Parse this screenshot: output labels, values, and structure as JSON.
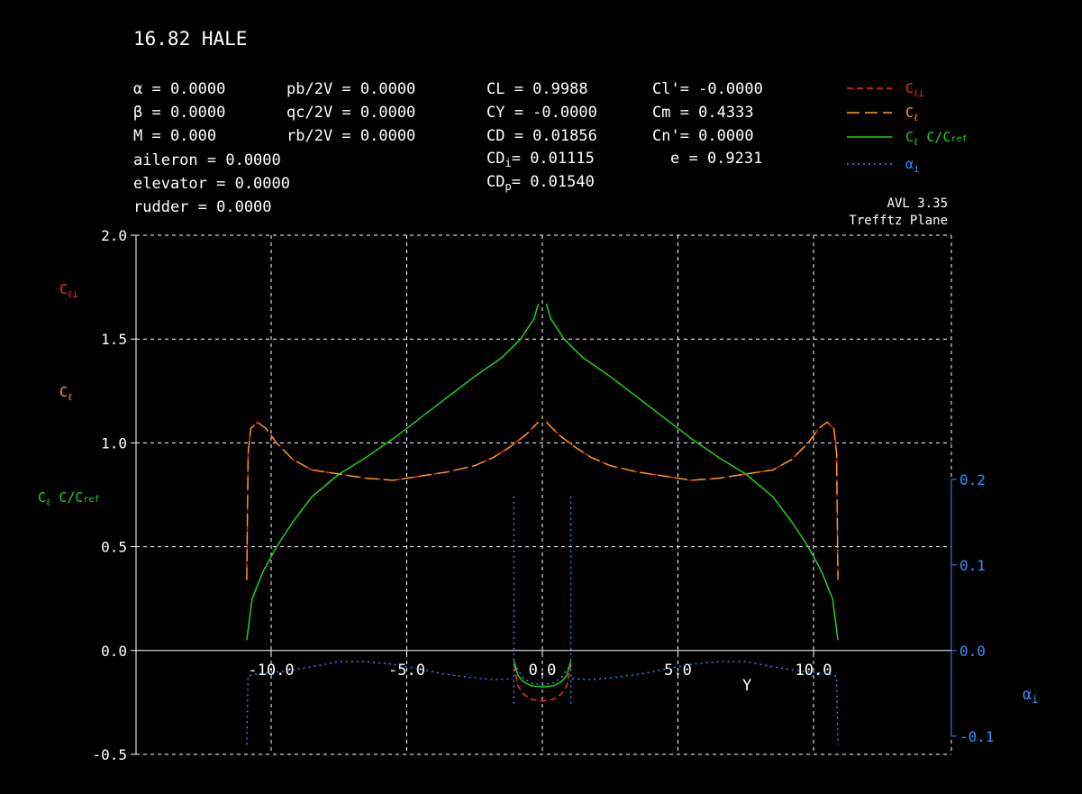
{
  "title": "16.82 HALE",
  "params": {
    "alpha": "α = 0.0000",
    "beta": "β = 0.0000",
    "mach": "M = 0.000",
    "pb2v": "pb/2V = 0.0000",
    "qc2v": "qc/2V = 0.0000",
    "rb2v": "rb/2V = 0.0000",
    "aileron": "aileron  = 0.0000",
    "elevator": "elevator = 0.0000",
    "rudder": "rudder   = 0.0000",
    "CL": "CL = 0.9988",
    "CY": "CY = -0.0000",
    "CD": "CD = 0.01856",
    "CDi_label": "CD",
    "CDi_sub": "i",
    "CDi_value": "= 0.01115",
    "CDp_label": "CD",
    "CDp_sub": "p",
    "CDp_value": "= 0.01540",
    "Cl_prime": "Cl'= -0.0000",
    "Cm": "Cm = 0.4333",
    "Cn_prime": "Cn'= 0.0000",
    "e": "e = 0.9231"
  },
  "version": "AVL 3.35",
  "plane": "Trefftz Plane",
  "colors": {
    "cl_perp": "#ff2a1a",
    "cl": "#ffa020",
    "clc": "#20d020",
    "alpha_i": "#3090ff",
    "grid": "#ffffff",
    "background": "#000000"
  },
  "chart_data": {
    "type": "line",
    "xlabel": "Y",
    "x_ticks": [
      "-10.0",
      "-5.0",
      "0.0",
      "5.0",
      "10.0"
    ],
    "x_tick_values": [
      -10,
      -5,
      0,
      5,
      10
    ],
    "xlim": [
      -10,
      10
    ],
    "ylim": [
      -0.5,
      2.0
    ],
    "y_ticks": [
      "-0.5",
      "0.0",
      "0.5",
      "1.0",
      "1.5",
      "2.0"
    ],
    "y_tick_values": [
      -0.5,
      0,
      0.5,
      1.0,
      1.5,
      2.0
    ],
    "y2lim": [
      -0.1,
      0.2
    ],
    "y2_ticks": [
      "-0.1",
      "0.0",
      "0.1",
      "0.2"
    ],
    "y2_tick_values": [
      -0.1,
      0,
      0.1,
      0.2
    ],
    "legend": [
      {
        "key": "cl_perp",
        "main": "C",
        "sub": "ℓ⊥"
      },
      {
        "key": "cl",
        "main": "C",
        "sub": "ℓ"
      },
      {
        "key": "clc",
        "main": "C",
        "sub": "ℓ",
        "tail": " C/C",
        "tail_sub": "ref"
      },
      {
        "key": "alpha_i",
        "main": "α",
        "sub": "i"
      }
    ],
    "axis_labels": {
      "cl_perp": {
        "main": "C",
        "sub": "ℓ⊥"
      },
      "cl": {
        "main": "C",
        "sub": "ℓ"
      },
      "clc": {
        "main": "C",
        "sub": "ℓ",
        "tail": " C/C",
        "tail_sub": "ref"
      },
      "alpha_i": {
        "main": "α",
        "sub": "i"
      }
    },
    "series": [
      {
        "key": "cl_perp",
        "style": "dashed-short",
        "segments": [
          [
            [
              -10.9,
              0.34
            ],
            [
              -10.85,
              0.95
            ],
            [
              -10.75,
              1.07
            ],
            [
              -10.5,
              1.1
            ],
            [
              -10.2,
              1.07
            ],
            [
              -9.8,
              1.0
            ],
            [
              -9.2,
              0.92
            ],
            [
              -8.5,
              0.87
            ],
            [
              -7.5,
              0.85
            ],
            [
              -6.5,
              0.83
            ],
            [
              -5.5,
              0.82
            ],
            [
              -4.5,
              0.84
            ],
            [
              -3.5,
              0.86
            ],
            [
              -2.5,
              0.89
            ],
            [
              -1.8,
              0.93
            ],
            [
              -1.2,
              0.98
            ],
            [
              -0.6,
              1.04
            ],
            [
              -0.15,
              1.1
            ]
          ],
          [
            [
              0.15,
              1.1
            ],
            [
              0.6,
              1.04
            ],
            [
              1.2,
              0.98
            ],
            [
              1.8,
              0.93
            ],
            [
              2.5,
              0.89
            ],
            [
              3.5,
              0.86
            ],
            [
              4.5,
              0.84
            ],
            [
              5.5,
              0.82
            ],
            [
              6.5,
              0.83
            ],
            [
              7.5,
              0.85
            ],
            [
              8.5,
              0.87
            ],
            [
              9.2,
              0.92
            ],
            [
              9.8,
              1.0
            ],
            [
              10.2,
              1.07
            ],
            [
              10.5,
              1.1
            ],
            [
              10.75,
              1.07
            ],
            [
              10.85,
              0.95
            ],
            [
              10.9,
              0.34
            ]
          ],
          [
            [
              -1.05,
              -0.07
            ],
            [
              -0.9,
              -0.17
            ],
            [
              -0.7,
              -0.21
            ],
            [
              -0.4,
              -0.235
            ],
            [
              0,
              -0.245
            ],
            [
              0.4,
              -0.235
            ],
            [
              0.7,
              -0.21
            ],
            [
              0.9,
              -0.17
            ],
            [
              1.05,
              -0.07
            ]
          ]
        ]
      },
      {
        "key": "cl",
        "style": "dashed-long",
        "segments": [
          [
            [
              -10.9,
              0.34
            ],
            [
              -10.85,
              0.95
            ],
            [
              -10.75,
              1.07
            ],
            [
              -10.5,
              1.1
            ],
            [
              -10.2,
              1.07
            ],
            [
              -9.8,
              1.0
            ],
            [
              -9.2,
              0.92
            ],
            [
              -8.5,
              0.87
            ],
            [
              -7.5,
              0.85
            ],
            [
              -6.5,
              0.83
            ],
            [
              -5.5,
              0.82
            ],
            [
              -4.5,
              0.84
            ],
            [
              -3.5,
              0.86
            ],
            [
              -2.5,
              0.89
            ],
            [
              -1.8,
              0.93
            ],
            [
              -1.2,
              0.98
            ],
            [
              -0.6,
              1.04
            ],
            [
              -0.15,
              1.1
            ]
          ],
          [
            [
              0.15,
              1.1
            ],
            [
              0.6,
              1.04
            ],
            [
              1.2,
              0.98
            ],
            [
              1.8,
              0.93
            ],
            [
              2.5,
              0.89
            ],
            [
              3.5,
              0.86
            ],
            [
              4.5,
              0.84
            ],
            [
              5.5,
              0.82
            ],
            [
              6.5,
              0.83
            ],
            [
              7.5,
              0.85
            ],
            [
              8.5,
              0.87
            ],
            [
              9.2,
              0.92
            ],
            [
              9.8,
              1.0
            ],
            [
              10.2,
              1.07
            ],
            [
              10.5,
              1.1
            ],
            [
              10.75,
              1.07
            ],
            [
              10.85,
              0.95
            ],
            [
              10.9,
              0.34
            ]
          ]
        ]
      },
      {
        "key": "clc",
        "style": "solid",
        "segments": [
          [
            [
              -10.9,
              0.05
            ],
            [
              -10.7,
              0.25
            ],
            [
              -10.3,
              0.38
            ],
            [
              -9.8,
              0.5
            ],
            [
              -9.2,
              0.62
            ],
            [
              -8.5,
              0.74
            ],
            [
              -7.5,
              0.85
            ],
            [
              -6.5,
              0.93
            ],
            [
              -5.5,
              1.02
            ],
            [
              -4.5,
              1.12
            ],
            [
              -3.5,
              1.22
            ],
            [
              -2.5,
              1.32
            ],
            [
              -1.5,
              1.41
            ],
            [
              -0.8,
              1.5
            ],
            [
              -0.3,
              1.6
            ],
            [
              -0.15,
              1.67
            ]
          ],
          [
            [
              0.15,
              1.67
            ],
            [
              0.3,
              1.6
            ],
            [
              0.8,
              1.5
            ],
            [
              1.5,
              1.41
            ],
            [
              2.5,
              1.32
            ],
            [
              3.5,
              1.22
            ],
            [
              4.5,
              1.12
            ],
            [
              5.5,
              1.02
            ],
            [
              6.5,
              0.93
            ],
            [
              7.5,
              0.85
            ],
            [
              8.5,
              0.74
            ],
            [
              9.2,
              0.62
            ],
            [
              9.8,
              0.5
            ],
            [
              10.3,
              0.38
            ],
            [
              10.7,
              0.25
            ],
            [
              10.9,
              0.05
            ]
          ],
          [
            [
              -1.05,
              -0.05
            ],
            [
              -0.9,
              -0.12
            ],
            [
              -0.7,
              -0.15
            ],
            [
              -0.4,
              -0.17
            ],
            [
              0,
              -0.175
            ],
            [
              0.4,
              -0.17
            ],
            [
              0.7,
              -0.15
            ],
            [
              0.9,
              -0.12
            ],
            [
              1.05,
              -0.05
            ]
          ]
        ]
      },
      {
        "key": "alpha_i",
        "style": "dotted",
        "axis": "right",
        "segments": [
          [
            [
              -10.9,
              -0.11
            ],
            [
              -10.85,
              -0.03
            ],
            [
              -10.5,
              -0.027
            ],
            [
              -9.5,
              -0.024
            ],
            [
              -8.5,
              -0.019
            ],
            [
              -7.5,
              -0.013
            ],
            [
              -6.5,
              -0.013
            ],
            [
              -5.5,
              -0.016
            ],
            [
              -4.5,
              -0.022
            ],
            [
              -3.5,
              -0.028
            ],
            [
              -2.5,
              -0.032
            ],
            [
              -1.8,
              -0.034
            ],
            [
              -1.1,
              -0.033
            ]
          ],
          [
            [
              1.1,
              -0.033
            ],
            [
              1.8,
              -0.034
            ],
            [
              2.5,
              -0.032
            ],
            [
              3.5,
              -0.028
            ],
            [
              4.5,
              -0.022
            ],
            [
              5.5,
              -0.016
            ],
            [
              6.5,
              -0.013
            ],
            [
              7.5,
              -0.013
            ],
            [
              8.5,
              -0.019
            ],
            [
              9.5,
              -0.024
            ],
            [
              10.5,
              -0.027
            ],
            [
              10.85,
              -0.03
            ],
            [
              10.9,
              -0.11
            ]
          ],
          [
            [
              -1.05,
              0.18
            ],
            [
              -1.05,
              -0.065
            ]
          ],
          [
            [
              1.05,
              0.18
            ],
            [
              1.05,
              -0.065
            ]
          ],
          [
            [
              -0.95,
              -0.02
            ],
            [
              -0.7,
              -0.032
            ],
            [
              -0.4,
              -0.038
            ],
            [
              0,
              -0.04
            ],
            [
              0.4,
              -0.038
            ],
            [
              0.7,
              -0.032
            ],
            [
              0.95,
              -0.02
            ]
          ]
        ]
      }
    ]
  }
}
